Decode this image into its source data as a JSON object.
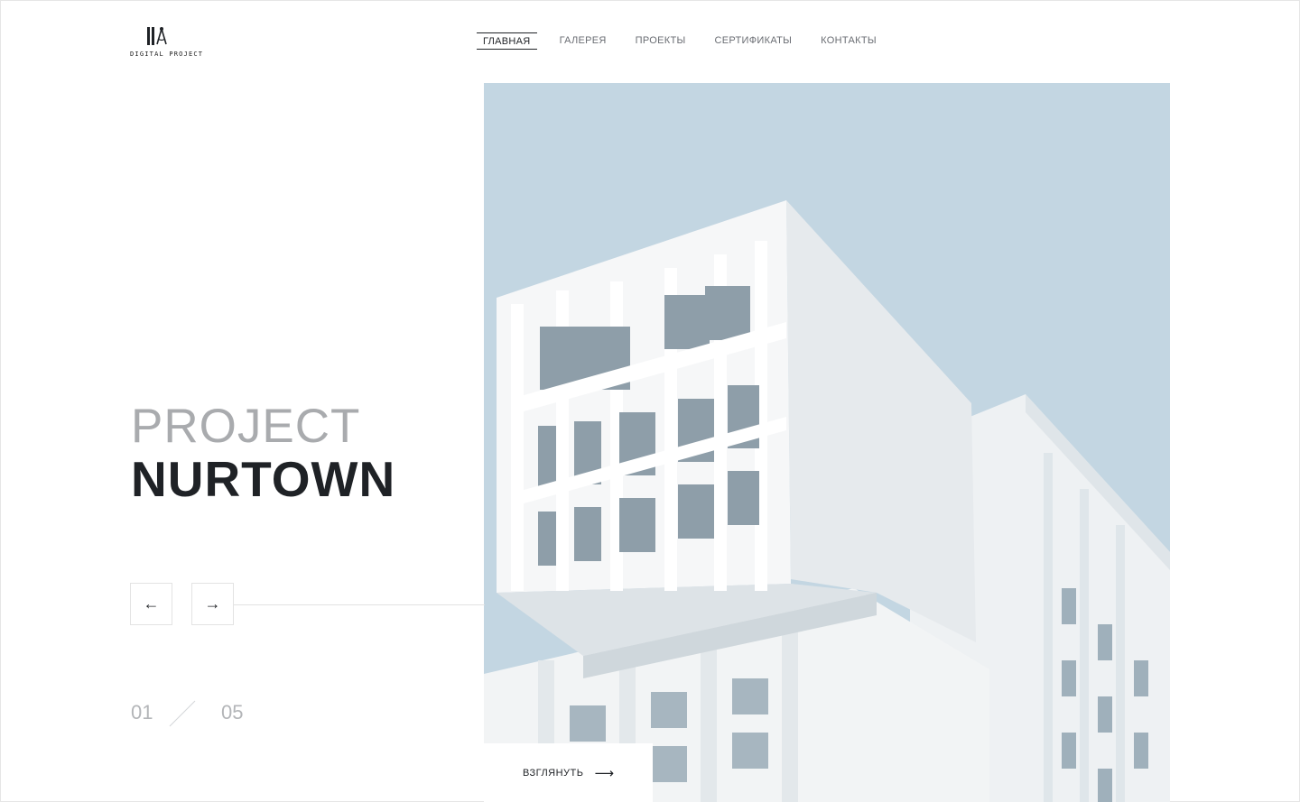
{
  "logo": {
    "text": "DIGITAL PROJECT",
    "icon": "compass-logo-icon"
  },
  "nav": {
    "items": [
      {
        "label": "ГЛАВНАЯ",
        "active": true
      },
      {
        "label": "ГАЛЕРЕЯ",
        "active": false
      },
      {
        "label": "ПРОЕКТЫ",
        "active": false
      },
      {
        "label": "СЕРТИФИКАТЫ",
        "active": false
      },
      {
        "label": "КОНТАКТЫ",
        "active": false
      }
    ]
  },
  "hero": {
    "title_light": "PROJECT",
    "title_bold": "NURTOWN",
    "image": "white-modern-building-photo"
  },
  "slider": {
    "prev_icon": "arrow-left-icon",
    "next_icon": "arrow-right-icon",
    "prev_glyph": "←",
    "next_glyph": "→",
    "current": "01",
    "total": "05"
  },
  "cta": {
    "label": "ВЗГЛЯНУТЬ",
    "icon": "arrow-right-icon",
    "glyph": "⟶"
  },
  "colors": {
    "text": "#1f2226",
    "muted": "#a9abae",
    "sky": "#c3d6e2",
    "border": "#e3e3e3"
  }
}
